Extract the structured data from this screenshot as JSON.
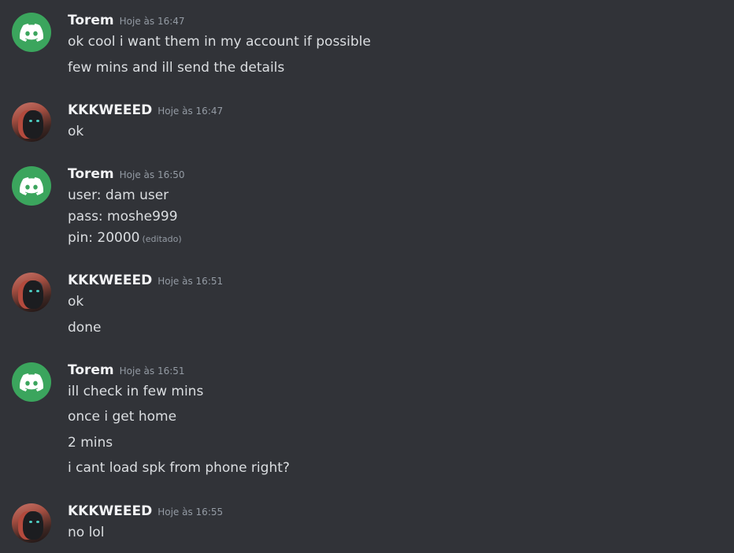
{
  "messages": [
    {
      "author": "Torem",
      "timestamp": "Hoje às 16:47",
      "avatar": "discord-icon",
      "lines": [
        "ok cool i want them in my account if possible",
        "few mins and ill send the details"
      ]
    },
    {
      "author": "KKKWEEED",
      "timestamp": "Hoje às 16:47",
      "avatar": "user-photo",
      "lines": [
        "ok"
      ]
    },
    {
      "author": "Torem",
      "timestamp": "Hoje às 16:50",
      "avatar": "discord-icon",
      "lines": [
        "user: dam user",
        "pass: moshe999",
        "pin: 20000"
      ],
      "edited_label": "(editado)"
    },
    {
      "author": "KKKWEEED",
      "timestamp": "Hoje às 16:51",
      "avatar": "user-photo",
      "lines": [
        "ok",
        "done"
      ]
    },
    {
      "author": "Torem",
      "timestamp": "Hoje às 16:51",
      "avatar": "discord-icon",
      "lines": [
        "ill check in few mins",
        "once i get home",
        "2 mins",
        "i cant load spk from phone right?"
      ]
    },
    {
      "author": "KKKWEEED",
      "timestamp": "Hoje às 16:55",
      "avatar": "user-photo",
      "lines": [
        "no lol"
      ]
    }
  ],
  "colors": {
    "background": "#313338",
    "discord_green": "#3ba55d",
    "username": "#f2f3f5",
    "text": "#dbdee1",
    "muted": "#949ba4"
  }
}
